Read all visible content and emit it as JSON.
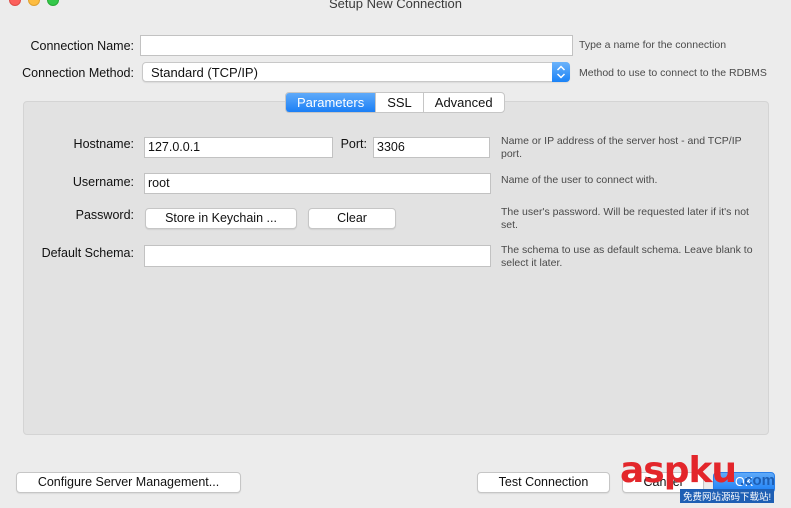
{
  "window": {
    "title": "Setup New Connection"
  },
  "connection_name": {
    "label": "Connection Name:",
    "value": "",
    "hint": "Type a name for the connection"
  },
  "connection_method": {
    "label": "Connection Method:",
    "value": "Standard (TCP/IP)",
    "hint": "Method to use to connect to the RDBMS"
  },
  "tabs": [
    {
      "label": "Parameters",
      "active": true
    },
    {
      "label": "SSL",
      "active": false
    },
    {
      "label": "Advanced",
      "active": false
    }
  ],
  "params": {
    "hostname": {
      "label": "Hostname:",
      "value": "127.0.0.1"
    },
    "port": {
      "label": "Port:",
      "value": "3306"
    },
    "host_hint": "Name or IP address of the server host - and TCP/IP port.",
    "username": {
      "label": "Username:",
      "value": "root",
      "hint": "Name of the user to connect with."
    },
    "password": {
      "label": "Password:",
      "store_label": "Store in Keychain ...",
      "clear_label": "Clear",
      "hint": "The user's password. Will be requested later if it's not set."
    },
    "default_schema": {
      "label": "Default Schema:",
      "value": "",
      "hint": "The schema to use as default schema. Leave blank to select it later."
    }
  },
  "footer": {
    "configure_label": "Configure Server Management...",
    "test_label": "Test Connection",
    "cancel_label": "Cancel",
    "ok_label": "OK"
  },
  "watermark": {
    "brand": "aspku",
    "domain": ".com",
    "tagline": "免费网站源码下载站!"
  },
  "colors": {
    "accent": "#1b7ff6",
    "window_bg": "#ececec",
    "panel_bg": "#e2e2e2",
    "watermark_red": "#e3262b",
    "watermark_blue": "#1e5fb4"
  }
}
